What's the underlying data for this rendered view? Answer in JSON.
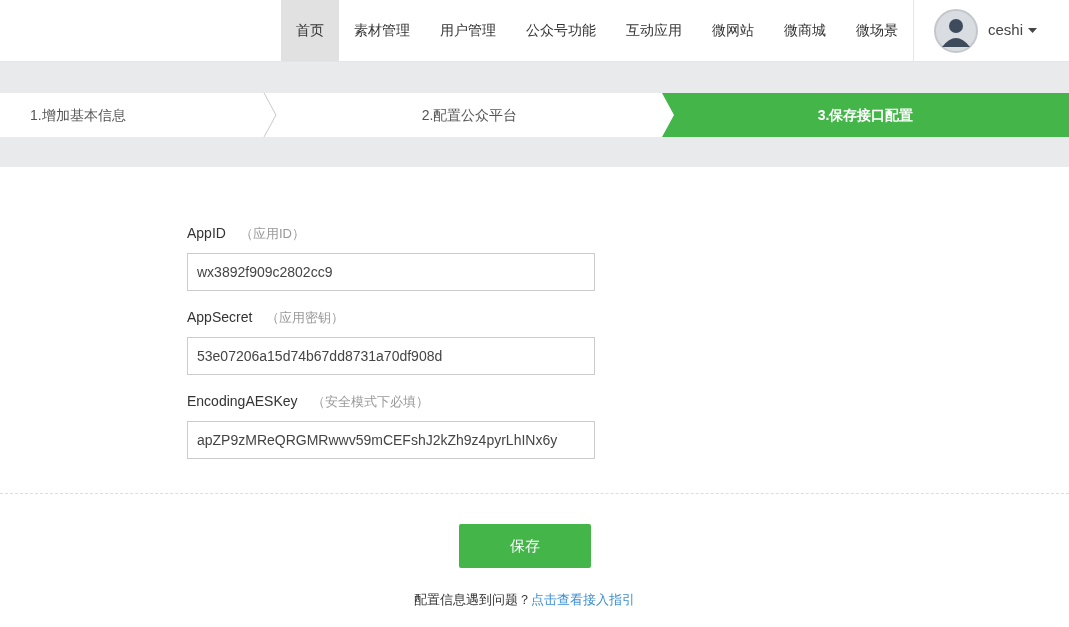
{
  "nav": {
    "items": [
      {
        "label": "首页",
        "selected": true
      },
      {
        "label": "素材管理",
        "selected": false
      },
      {
        "label": "用户管理",
        "selected": false
      },
      {
        "label": "公众号功能",
        "selected": false
      },
      {
        "label": "互动应用",
        "selected": false
      },
      {
        "label": "微网站",
        "selected": false
      },
      {
        "label": "微商城",
        "selected": false
      },
      {
        "label": "微场景",
        "selected": false
      }
    ],
    "user": "ceshi"
  },
  "steps": [
    {
      "label": "1.增加基本信息",
      "selected": false
    },
    {
      "label": "2.配置公众平台",
      "selected": false
    },
    {
      "label": "3.保存接口配置",
      "selected": true
    }
  ],
  "fields": [
    {
      "label": "AppID",
      "hint": "（应用ID）",
      "value": "wx3892f909c2802cc9"
    },
    {
      "label": "AppSecret",
      "hint": "（应用密钥）",
      "value": "53e07206a15d74b67dd8731a70df908d"
    },
    {
      "label": "EncodingAESKey",
      "hint": "（安全模式下必填）",
      "value": "apZP9zMReQRGMRwwv59mCEFshJ2kZh9z4pyrLhINx6y"
    }
  ],
  "save_button": "保存",
  "help": {
    "text": "配置信息遇到问题？",
    "link": "点击查看接入指引"
  }
}
